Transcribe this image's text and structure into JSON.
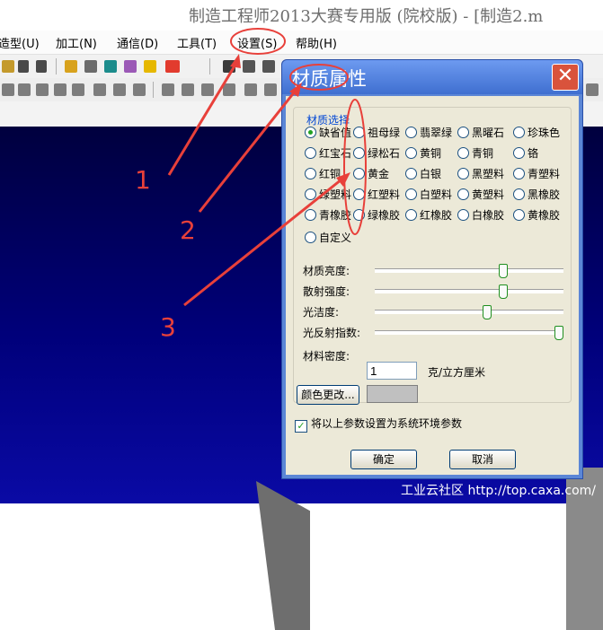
{
  "window": {
    "title": "制造工程师2013大赛专用版 (院校版) - [制造2.m"
  },
  "menu": [
    {
      "label": "造型(U)"
    },
    {
      "label": "加工(N)"
    },
    {
      "label": "通信(D)"
    },
    {
      "label": "工具(T)"
    },
    {
      "label": "设置(S)"
    },
    {
      "label": "帮助(H)"
    }
  ],
  "dialog": {
    "title": "材质属性",
    "close_glyph": "✕",
    "group_title": "材质选择",
    "materials": [
      [
        "缺省值",
        "祖母绿",
        "翡翠绿",
        "黑曜石",
        "珍珠色"
      ],
      [
        "红宝石",
        "绿松石",
        "黄铜",
        "青铜",
        "铬"
      ],
      [
        "红铜",
        "黄金",
        "白银",
        "黑塑料",
        "青塑料"
      ],
      [
        "绿塑料",
        "红塑料",
        "白塑料",
        "黄塑料",
        "黑橡胶"
      ],
      [
        "青橡胶",
        "绿橡胶",
        "红橡胶",
        "白橡胶",
        "黄橡胶"
      ],
      [
        "自定义"
      ]
    ],
    "selected_material": "缺省值",
    "sliders": [
      {
        "label": "材质亮度:",
        "value": 0.69
      },
      {
        "label": "散射强度:",
        "value": 0.69
      },
      {
        "label": "光洁度:",
        "value": 0.6
      },
      {
        "label": "光反射指数:",
        "value": 1.0
      }
    ],
    "density": {
      "label": "材料密度:",
      "value": "1",
      "unit": "克/立方厘米"
    },
    "color_button": "颜色更改...",
    "swatch_color": "#c0c0c0",
    "checkbox": {
      "label": "将以上参数设置为系统环境参数",
      "checked": true,
      "mark": "✓"
    },
    "ok_button": "确定",
    "cancel_button": "取消"
  },
  "annotations": {
    "numbers": [
      "1",
      "2",
      "3"
    ],
    "color": "#e8403a"
  },
  "watermark": "工业云社区 http://top.caxa.com/"
}
